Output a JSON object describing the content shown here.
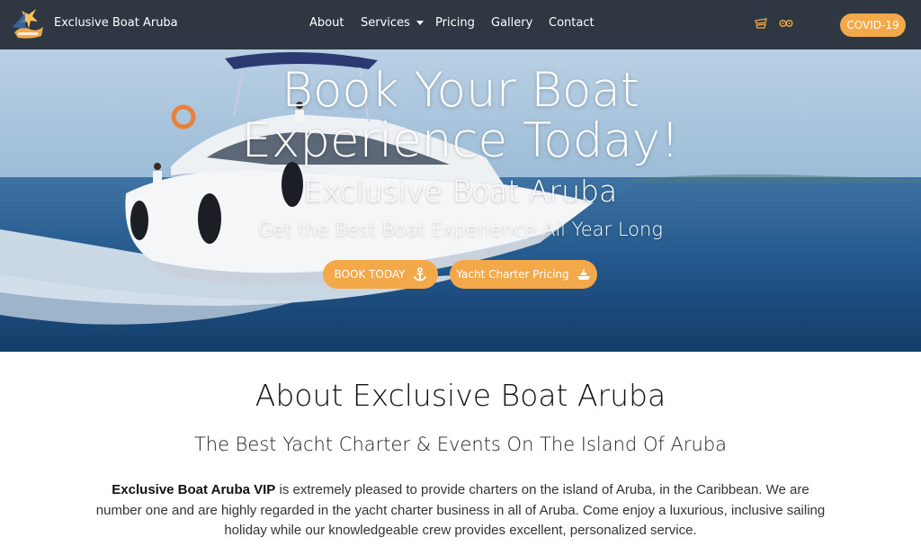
{
  "nav": {
    "brand": "Exclusive Boat Aruba",
    "items": [
      {
        "label": "About"
      },
      {
        "label": "Services"
      },
      {
        "label": "Pricing"
      },
      {
        "label": "Gallery"
      },
      {
        "label": "Contact"
      }
    ],
    "covid_label": "COVID-19",
    "social_icons": [
      "tripadvisor-review-icon",
      "tripadvisor-icon"
    ]
  },
  "hero": {
    "title": "Book Your Boat Experience Today!",
    "subtitle": "Exclusive Boat Aruba",
    "tagline": "Get the Best Boat Experience All Year Long",
    "book_button": "BOOK TODAY",
    "pricing_button": "Yacht Charter Pricing",
    "book_icon": "anchor-icon",
    "pricing_icon": "boat-icon"
  },
  "about": {
    "title": "About Exclusive Boat Aruba",
    "subtitle": "The Best Yacht Charter & Events On The Island Of Aruba",
    "body_bold": "Exclusive Boat Aruba VIP",
    "body_text": " is extremely pleased to provide charters on the island of Aruba, in the Caribbean. We are number one and are highly regarded in the yacht charter business in all of Aruba. Come enjoy a luxurious, inclusive sailing holiday while our knowledgeable crew provides excellent, personalized service."
  },
  "colors": {
    "nav_bg": "#2f3742",
    "accent": "#f3a84a"
  }
}
